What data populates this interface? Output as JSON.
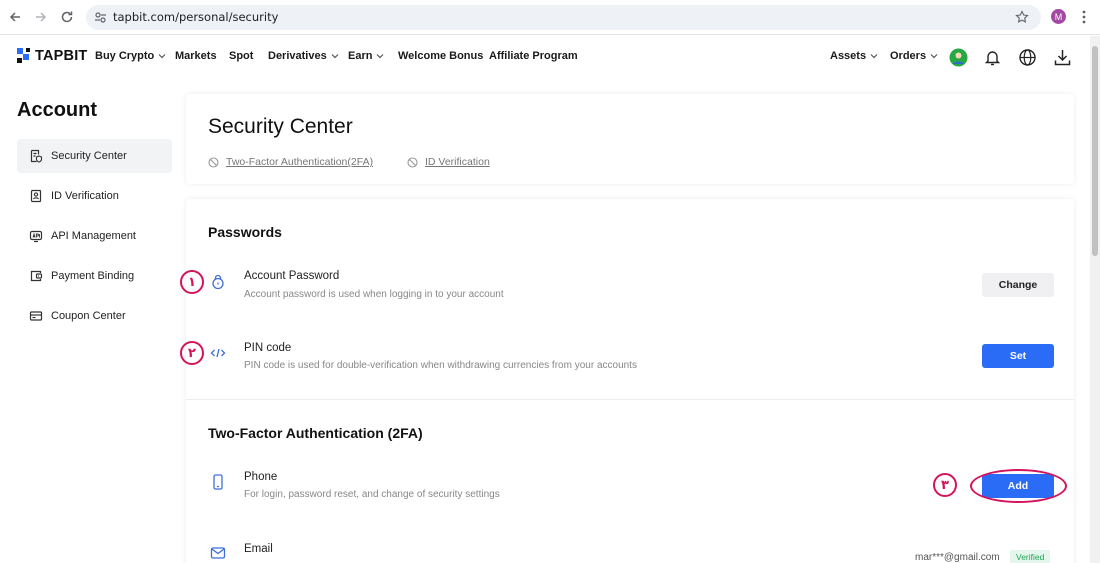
{
  "browser": {
    "url": "tapbit.com/personal/security",
    "profile_initial": "M"
  },
  "header": {
    "logo": "TAPBIT",
    "nav": [
      {
        "label": "Buy Crypto",
        "dropdown": true
      },
      {
        "label": "Markets",
        "dropdown": false
      },
      {
        "label": "Spot",
        "dropdown": false
      },
      {
        "label": "Derivatives",
        "dropdown": true
      },
      {
        "label": "Earn",
        "dropdown": true
      },
      {
        "label": "Welcome Bonus",
        "dropdown": false
      },
      {
        "label": "Affiliate Program",
        "dropdown": false
      }
    ],
    "right": [
      {
        "label": "Assets",
        "dropdown": true
      },
      {
        "label": "Orders",
        "dropdown": true
      }
    ],
    "icons": [
      "avatar-icon",
      "bell-icon",
      "globe-icon",
      "download-icon"
    ]
  },
  "sidebar": {
    "title": "Account",
    "items": [
      {
        "label": "Security Center",
        "icon": "document-shield-icon",
        "active": true
      },
      {
        "label": "ID Verification",
        "icon": "id-card-icon",
        "active": false
      },
      {
        "label": "API Management",
        "icon": "api-icon",
        "active": false
      },
      {
        "label": "Payment Binding",
        "icon": "wallet-icon",
        "active": false
      },
      {
        "label": "Coupon Center",
        "icon": "coupon-icon",
        "active": false
      }
    ]
  },
  "main": {
    "title": "Security Center",
    "status_links": [
      {
        "label": "Two-Factor Authentication(2FA)",
        "icon": "ban-icon"
      },
      {
        "label": "ID Verification",
        "icon": "ban-icon"
      }
    ],
    "passwords": {
      "title": "Passwords",
      "rows": [
        {
          "title": "Account Password",
          "desc": "Account password is used when logging in to your account",
          "button": "Change",
          "icon": "lock-icon",
          "marker": "١"
        },
        {
          "title": "PIN code",
          "desc": "PIN code is used for double-verification when withdrawing currencies from your accounts",
          "button": "Set",
          "icon": "code-icon",
          "marker": "٢"
        }
      ]
    },
    "twofa": {
      "title": "Two-Factor Authentication (2FA)",
      "rows": [
        {
          "title": "Phone",
          "desc": "For login, password reset, and change of security settings",
          "button": "Add",
          "icon": "phone-icon",
          "marker": "٣"
        },
        {
          "title": "Email",
          "value": "mar***@gmail.com",
          "badge": "Verified",
          "icon": "mail-icon"
        }
      ]
    }
  },
  "colors": {
    "accent": "#2b6cf6",
    "annotation": "#d4145a",
    "verified": "#22a35a"
  }
}
